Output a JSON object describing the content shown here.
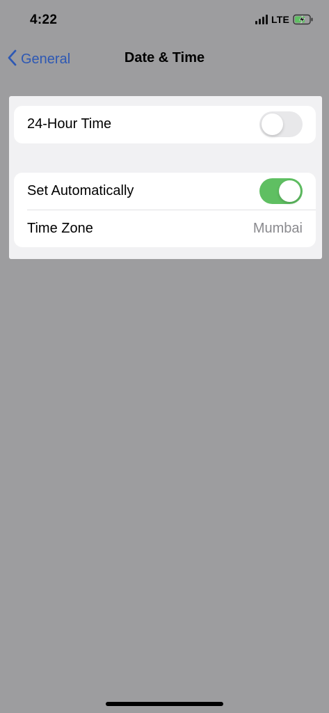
{
  "status_bar": {
    "time": "4:22",
    "network": "LTE",
    "battery_state": "charging"
  },
  "nav": {
    "back_label": "General",
    "title": "Date & Time"
  },
  "settings": {
    "hour24": {
      "label": "24-Hour Time",
      "enabled": false
    },
    "set_automatically": {
      "label": "Set Automatically",
      "enabled": true
    },
    "time_zone": {
      "label": "Time Zone",
      "value": "Mumbai"
    }
  },
  "colors": {
    "accent": "#2d58b4",
    "toggle_on": "#5fbf62",
    "toggle_off": "#e8e8ea",
    "background_dim": "#9d9d9f"
  }
}
